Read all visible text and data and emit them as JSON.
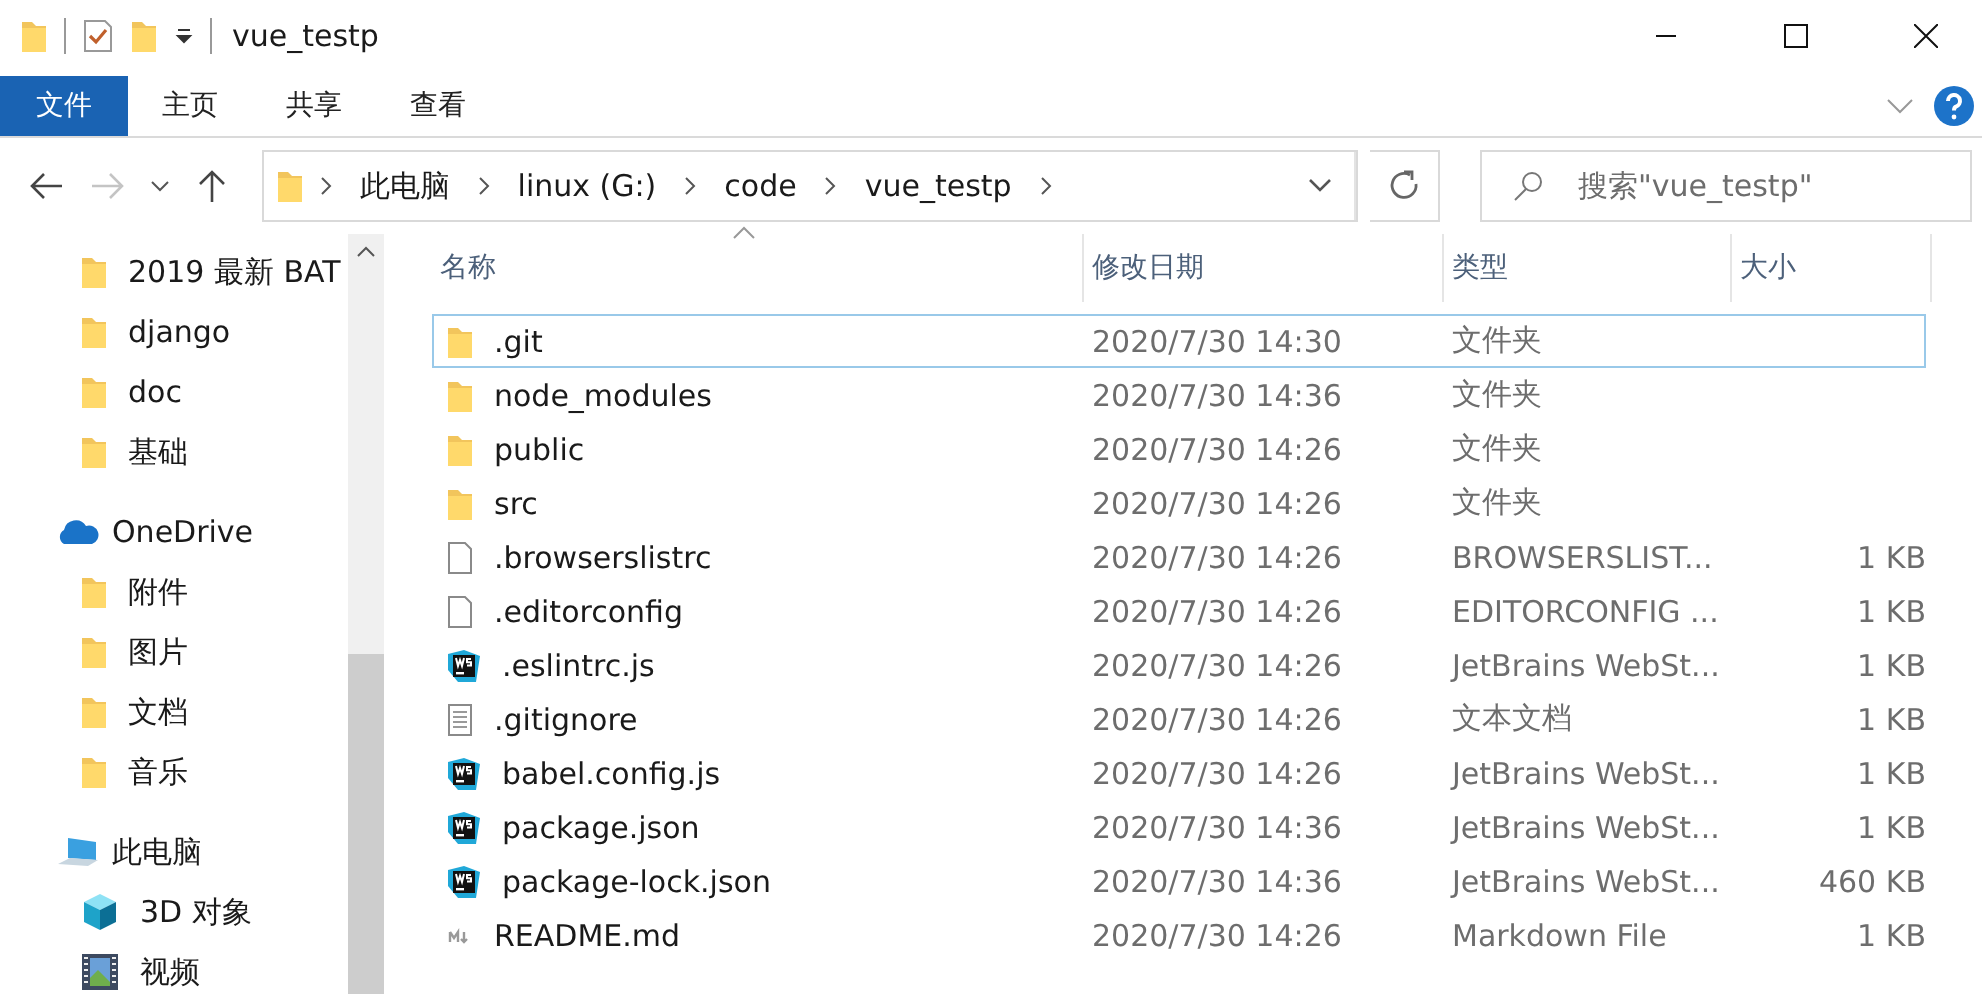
{
  "window": {
    "title": "vue_testp"
  },
  "ribbon": {
    "tabs": [
      {
        "label": "文件",
        "kind": "file"
      },
      {
        "label": "主页",
        "kind": "tab"
      },
      {
        "label": "共享",
        "kind": "tab"
      },
      {
        "label": "查看",
        "kind": "tab"
      }
    ]
  },
  "address_bar": {
    "forward_disabled": true,
    "path": [
      "此电脑",
      "linux (G:)",
      "code",
      "vue_testp"
    ]
  },
  "search": {
    "placeholder": "搜索\"vue_testp\""
  },
  "sidebar": {
    "quick_access_children": [
      {
        "label": "2019 最新 BAT",
        "kind": "folder"
      },
      {
        "label": "django",
        "kind": "folder"
      },
      {
        "label": "doc",
        "kind": "folder"
      },
      {
        "label": "基础",
        "kind": "folder"
      }
    ],
    "items": [
      {
        "label": "OneDrive",
        "kind": "cloud",
        "children": [
          {
            "label": "附件",
            "kind": "folder"
          },
          {
            "label": "图片",
            "kind": "folder"
          },
          {
            "label": "文档",
            "kind": "folder"
          },
          {
            "label": "音乐",
            "kind": "folder"
          }
        ]
      },
      {
        "label": "此电脑",
        "kind": "pc",
        "children": [
          {
            "label": "3D 对象",
            "kind": "cube"
          },
          {
            "label": "视频",
            "kind": "video"
          }
        ]
      }
    ]
  },
  "table": {
    "columns": [
      "名称",
      "修改日期",
      "类型",
      "大小"
    ],
    "rows": [
      {
        "name": ".git",
        "modified": "2020/7/30 14:30",
        "type": "文件夹",
        "kind": "folder",
        "focused": true
      },
      {
        "name": "node_modules",
        "modified": "2020/7/30 14:36",
        "type": "文件夹",
        "kind": "folder",
        "focused": false
      },
      {
        "name": "public",
        "modified": "2020/7/30 14:26",
        "type": "文件夹",
        "kind": "folder",
        "focused": false
      },
      {
        "name": "src",
        "modified": "2020/7/30 14:26",
        "type": "文件夹",
        "kind": "folder",
        "focused": false
      },
      {
        "name": ".browserslistrc",
        "modified": "2020/7/30 14:26",
        "type": "BROWSERSLIST...",
        "size": "1 KB",
        "kind": "file",
        "focused": false
      },
      {
        "name": ".editorconfig",
        "modified": "2020/7/30 14:26",
        "type": "EDITORCONFIG ...",
        "size": "1 KB",
        "kind": "file",
        "focused": false
      },
      {
        "name": ".eslintrc.js",
        "modified": "2020/7/30 14:26",
        "type": "JetBrains WebSt...",
        "size": "1 KB",
        "kind": "webstorm",
        "focused": false
      },
      {
        "name": ".gitignore",
        "modified": "2020/7/30 14:26",
        "type": "文本文档",
        "size": "1 KB",
        "kind": "text",
        "focused": false
      },
      {
        "name": "babel.config.js",
        "modified": "2020/7/30 14:26",
        "type": "JetBrains WebSt...",
        "size": "1 KB",
        "kind": "webstorm",
        "focused": false
      },
      {
        "name": "package.json",
        "modified": "2020/7/30 14:36",
        "type": "JetBrains WebSt...",
        "size": "1 KB",
        "kind": "webstorm",
        "focused": false
      },
      {
        "name": "package-lock.json",
        "modified": "2020/7/30 14:36",
        "type": "JetBrains WebSt...",
        "size": "460 KB",
        "kind": "webstorm",
        "focused": false
      },
      {
        "name": "README.md",
        "modified": "2020/7/30 14:26",
        "type": "Markdown File",
        "size": "1 KB",
        "kind": "markdown",
        "focused": false
      }
    ]
  }
}
